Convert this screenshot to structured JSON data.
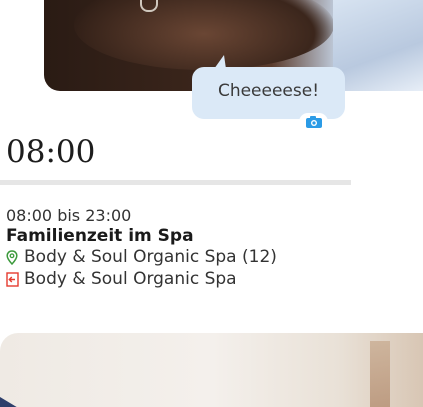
{
  "bubble": {
    "text": "Cheeeeese!"
  },
  "icons": {
    "camera": "camera-icon",
    "location": "location-pin-icon",
    "entrance": "entrance-icon"
  },
  "colors": {
    "bubble": "#dbe9f7",
    "camera": "#2b9be6",
    "pin": "#3c9a3c",
    "entrance": "#e53b2f"
  },
  "timeline": {
    "time": "08:00"
  },
  "event": {
    "time_range": "08:00 bis 23:00",
    "title": "Familienzeit im Spa",
    "location": "Body & Soul Organic Spa (12)",
    "venue": "Body & Soul Organic Spa"
  }
}
